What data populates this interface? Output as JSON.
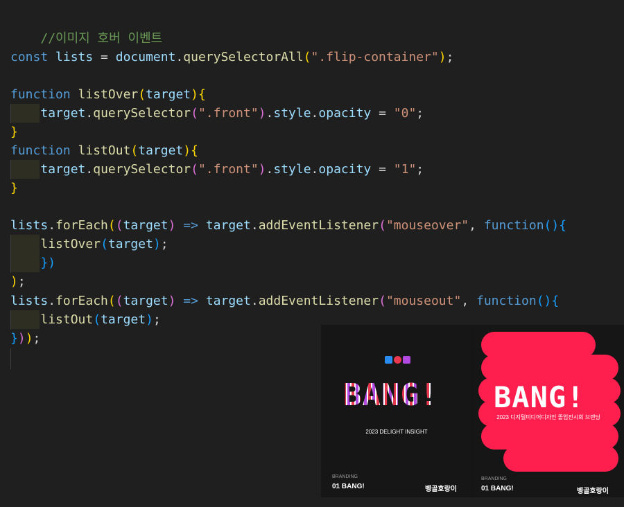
{
  "code": {
    "comment": "//이미지 호버 이벤트",
    "l1": {
      "kw": "const",
      "var": "lists",
      "eq": " = ",
      "obj": "document",
      "dot": ".",
      "fn": "querySelectorAll",
      "arg": "\".flip-container\"",
      "end": ";"
    },
    "l2": {
      "kw": "function",
      "fn": "listOver",
      "param": "target",
      "brace": "{"
    },
    "l3": {
      "var": "target",
      "fn": "querySelector",
      "arg": "\".front\"",
      "prop1": "style",
      "prop2": "opacity",
      "val": "\"0\""
    },
    "l5": {
      "kw": "function",
      "fn": "listOut",
      "param": "target"
    },
    "l6": {
      "val": "\"1\""
    },
    "l8": {
      "var": "lists",
      "fn": "forEach",
      "param": "target",
      "arrow": "=>",
      "fn2": "addEventListener",
      "evt": "\"mouseover\"",
      "kw": "function"
    },
    "l9": {
      "fn": "listOver",
      "arg": "target"
    },
    "l12": {
      "evt": "\"mouseout\""
    },
    "l13": {
      "fn": "listOut",
      "arg": "target"
    }
  },
  "thumb_a": {
    "logo": "BANG!",
    "subtitle": "2023 DELIGHT INSIGHT",
    "label": "BRANDING",
    "title": "01   BANG!",
    "brand": "벵골호랑이"
  },
  "thumb_b": {
    "logo": "BANG!",
    "subtitle": "2023 디지털미디어디자인 졸업전시회 브랜딩",
    "label": "BRANDING",
    "title": "01   BANG!",
    "brand": "벵골호랑이"
  },
  "colors": {
    "editor_bg": "#1f1f1f",
    "accent_red": "#ff1f4f",
    "purple": "#b249e0",
    "blue": "#2a8cf0"
  }
}
